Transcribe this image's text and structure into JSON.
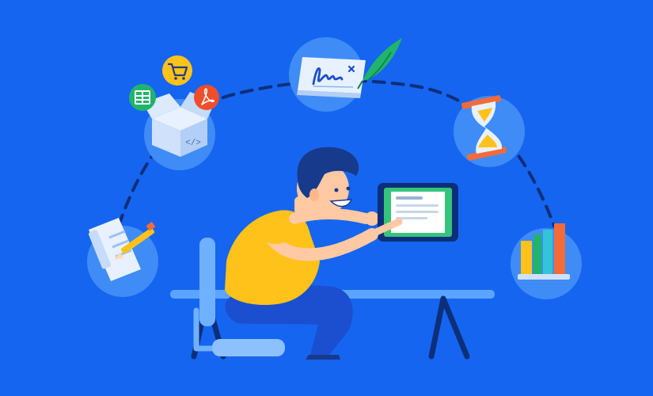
{
  "colors": {
    "background": "#1565f0",
    "circle": "#3f8cf7",
    "arc": "#0d2f7a",
    "shirt": "#ffc21a",
    "pants": "#1b4fcf",
    "hair": "#173a8c",
    "skin": "#ffc9a3",
    "tablet_screen": "#34c47c",
    "desk": "#5ba4ff",
    "chair": "#6fb0ff"
  },
  "icons": [
    "document-pencil-icon",
    "open-box-code-icon",
    "spreadsheet-icon",
    "shopping-cart-icon",
    "pdf-icon",
    "signature-card-icon",
    "feather-quill-icon",
    "hourglass-icon",
    "bar-chart-icon"
  ],
  "box_code_glyph": "</>"
}
